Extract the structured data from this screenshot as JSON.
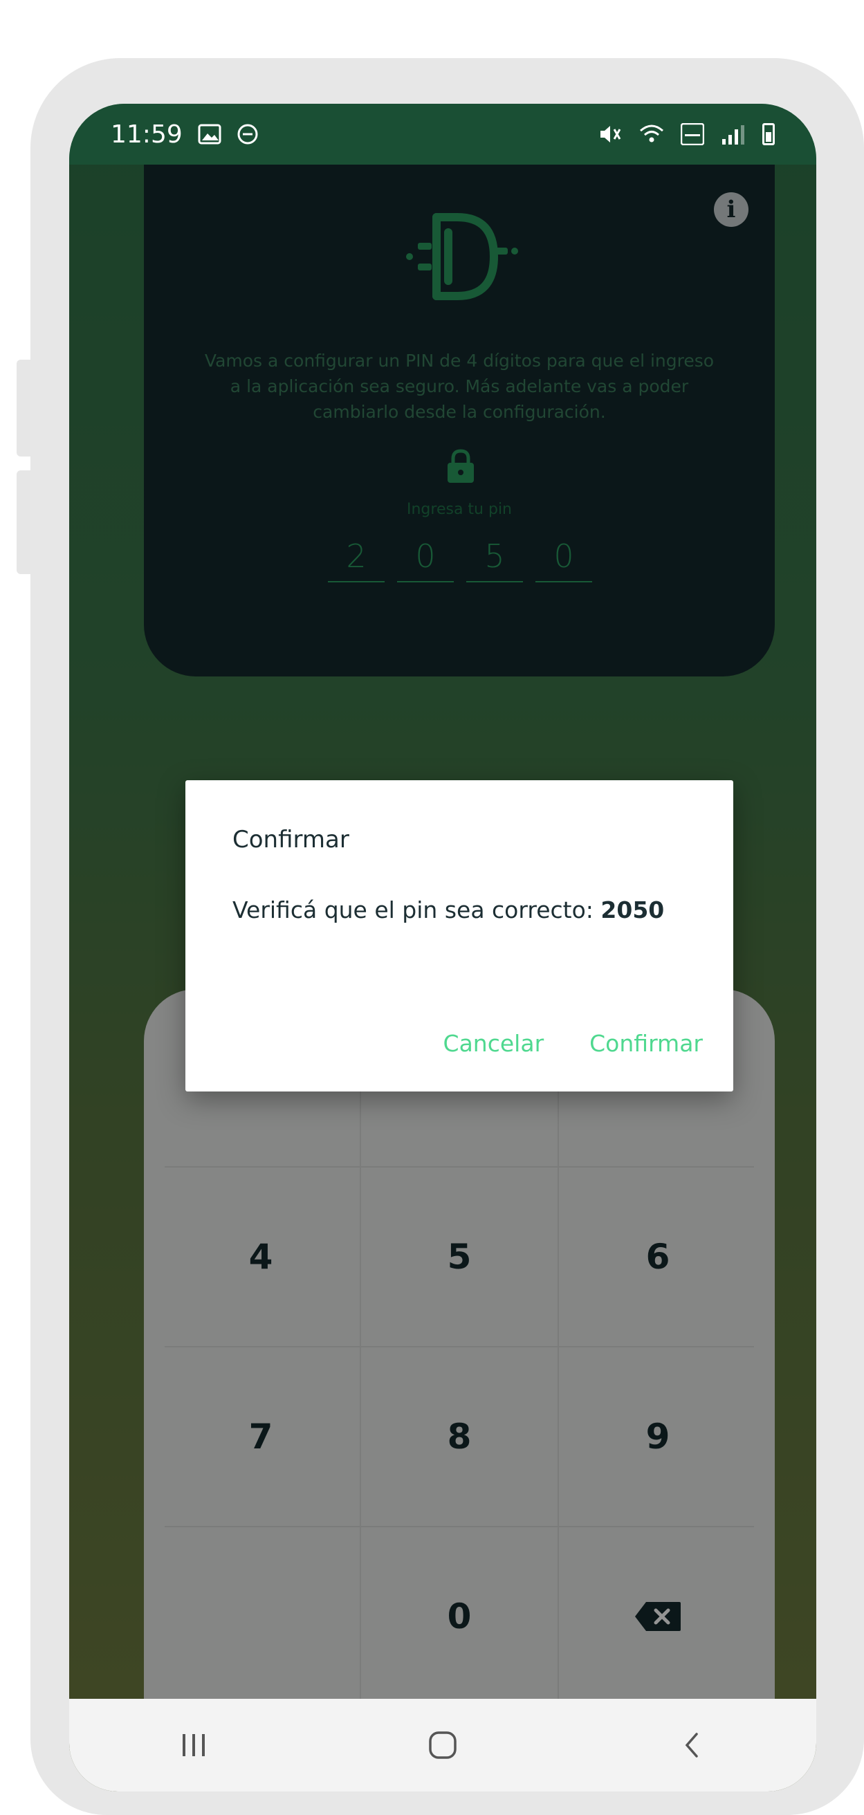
{
  "status_bar": {
    "time": "11:59"
  },
  "intro": {
    "text": "Vamos a configurar un PIN de 4 dígitos para que el ingreso a la aplicación sea seguro. Más adelante vas a poder cambiarlo desde la configuración."
  },
  "pin": {
    "label": "Ingresa tu pin",
    "digits": [
      "2",
      "0",
      "5",
      "0"
    ]
  },
  "keypad": {
    "keys": [
      "4",
      "5",
      "6",
      "7",
      "8",
      "9",
      "0"
    ]
  },
  "dialog": {
    "title": "Confirmar",
    "message": "Verificá que el pin sea correcto: ",
    "pin_value": "2050",
    "cancel_label": "Cancelar",
    "confirm_label": "Confirmar"
  },
  "colors": {
    "accent": "#4fd88f",
    "card": "#13282b",
    "status_bar": "#1a4f34"
  }
}
